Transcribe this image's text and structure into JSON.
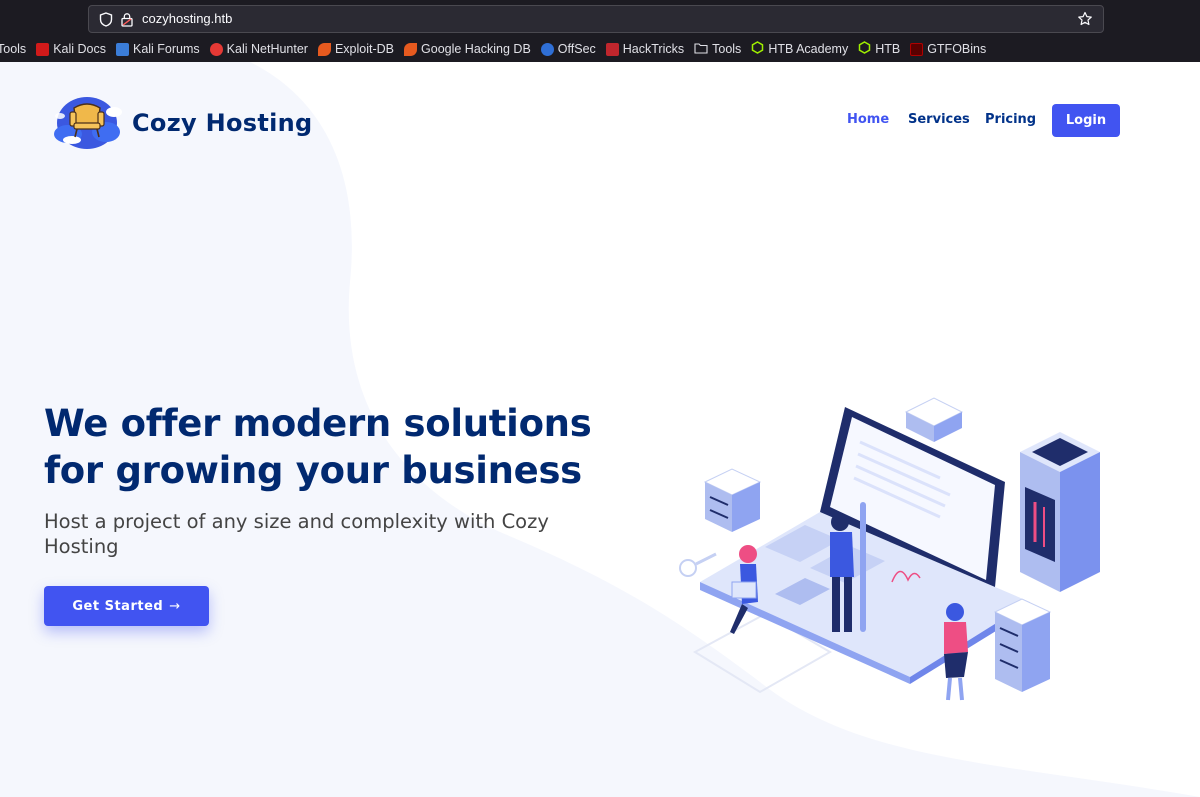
{
  "browser": {
    "url": "cozyhosting.htb",
    "bookmarks": [
      {
        "label": "Tools",
        "icon": "none"
      },
      {
        "label": "Kali Docs",
        "icon": "kali-docs-icon",
        "color": "#d11a1a"
      },
      {
        "label": "Kali Forums",
        "icon": "kali-forums-icon",
        "color": "#3b7dd8"
      },
      {
        "label": "Kali NetHunter",
        "icon": "kali-nethunter-icon",
        "color": "#e53935"
      },
      {
        "label": "Exploit-DB",
        "icon": "exploit-db-icon",
        "color": "#e65a1f"
      },
      {
        "label": "Google Hacking DB",
        "icon": "ghdb-icon",
        "color": "#e65a1f"
      },
      {
        "label": "OffSec",
        "icon": "offsec-icon",
        "color": "#2f6fd6"
      },
      {
        "label": "HackTricks",
        "icon": "hacktricks-icon",
        "color": "#c0262d"
      },
      {
        "label": "Tools",
        "icon": "folder-icon"
      },
      {
        "label": "HTB Academy",
        "icon": "htb-academy-icon",
        "color": "#9fef00"
      },
      {
        "label": "HTB",
        "icon": "htb-icon",
        "color": "#9fef00"
      },
      {
        "label": "GTFOBins",
        "icon": "gtfobins-icon",
        "color": "#b00000"
      }
    ]
  },
  "site": {
    "brand": "Cozy Hosting",
    "nav": [
      {
        "label": "Home",
        "active": true
      },
      {
        "label": "Services",
        "active": false
      },
      {
        "label": "Pricing",
        "active": false
      }
    ],
    "login_label": "Login"
  },
  "hero": {
    "title": "We offer modern solutions for growing your business",
    "subtitle": "Host a project of any size and complexity with Cozy Hosting",
    "cta_label": "Get Started",
    "cta_arrow": "→"
  },
  "colors": {
    "primary": "#4154f1",
    "heading": "#012970",
    "nav_text": "#013289",
    "chrome_bg": "#1c1b22"
  }
}
